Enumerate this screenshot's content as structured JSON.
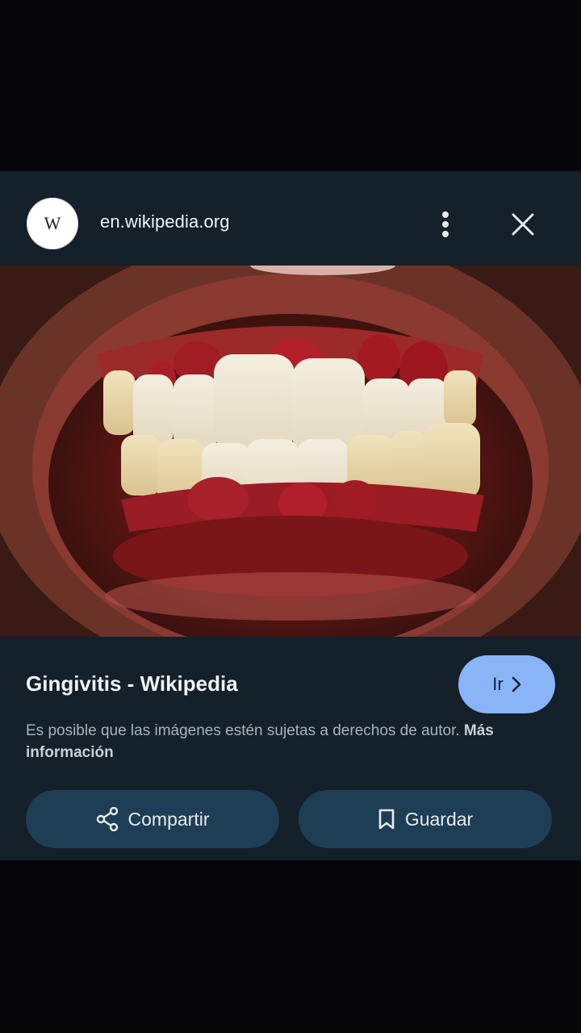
{
  "header": {
    "favicon_letter": "W",
    "domain": "en.wikipedia.org",
    "more_icon": "more-vert-icon",
    "close_icon": "close-icon"
  },
  "result": {
    "title": "Gingivitis - Wikipedia",
    "go_label": "Ir",
    "notice": "Es posible que las imágenes estén sujetas a derechos de autor.",
    "more_info": "Más información"
  },
  "actions": {
    "share_label": "Compartir",
    "save_label": "Guardar",
    "share_icon": "share-icon",
    "save_icon": "bookmark-icon"
  },
  "colors": {
    "background": "#07070b",
    "sheet": "#14202a",
    "accent": "#8ab4f8",
    "button": "#1e3e55"
  }
}
